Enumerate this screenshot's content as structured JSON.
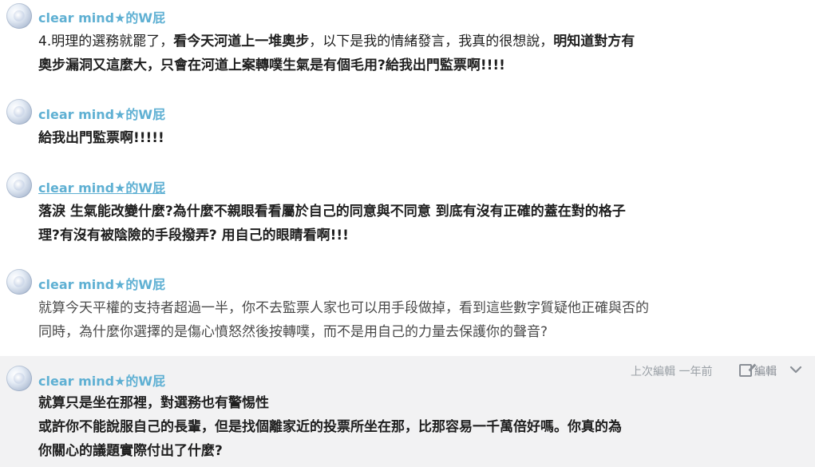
{
  "posts": [
    {
      "author": "clear mind★的W屁",
      "lines": [
        {
          "segments": [
            {
              "text": "4.明理的選務就罷了，",
              "bold": false
            },
            {
              "text": "看今天河道上一堆奧步",
              "bold": true
            },
            {
              "text": "，以下是我的情緒發言，我真的很想說，",
              "bold": false
            },
            {
              "text": "明知道對方有",
              "bold": true
            }
          ]
        },
        {
          "segments": [
            {
              "text": "奧步漏洞又這麼大，只會在河道上案轉噗生氣是有個毛用?給我出門監票啊!!!!",
              "bold": true
            }
          ]
        }
      ]
    },
    {
      "author": "clear mind★的W屁",
      "lines": [
        {
          "segments": [
            {
              "text": "給我出門監票啊!!!!!",
              "bold": true
            }
          ]
        }
      ]
    },
    {
      "author": "clear mind★的W屁",
      "lines": [
        {
          "segments": [
            {
              "text": "落淚 生氣能改變什麼?為什麼不親眼看看屬於自己的同意與不同意 到底有沒有正確的蓋在對的格子",
              "bold": true
            }
          ]
        },
        {
          "segments": [
            {
              "text": "理?有沒有被陰險的手段撥弄? 用自己的眼睛看啊!!!",
              "bold": true
            }
          ]
        }
      ]
    },
    {
      "author": "clear mind★的W屁",
      "lines": [
        {
          "segments": [
            {
              "text": "就算今天平權的支持者超過一半，你不去監票人家也可以用手段做掉，看到這些數字質疑他正確與否的",
              "bold": false
            }
          ]
        },
        {
          "segments": [
            {
              "text": "同時，為什麼你選擇的是傷心憤怒然後按轉噗，而不是用自己的力量去保護你的聲音?",
              "bold": false
            }
          ]
        }
      ]
    },
    {
      "author": "clear mind★的W屁",
      "meta": "上次編輯 一年前",
      "edit_label": "編輯",
      "lines": [
        {
          "segments": [
            {
              "text": "就算只是坐在那裡，對選務也有警惕性",
              "bold": true
            }
          ]
        },
        {
          "segments": [
            {
              "text": "或許你不能說服自己的長輩，但是找個離家近的投票所坐在那，比那容易一千萬倍好嗎。你真的為",
              "bold": true
            }
          ]
        },
        {
          "segments": [
            {
              "text": "你關心的議題實際付出了什麼?",
              "bold": true
            }
          ]
        }
      ]
    }
  ],
  "colors": {
    "author": "#5fb0d3",
    "highlight_bg": "#f2f2f3",
    "meta": "#9aa0a6"
  },
  "icons": [
    "avatar",
    "edit-icon",
    "chevron-down-icon"
  ]
}
